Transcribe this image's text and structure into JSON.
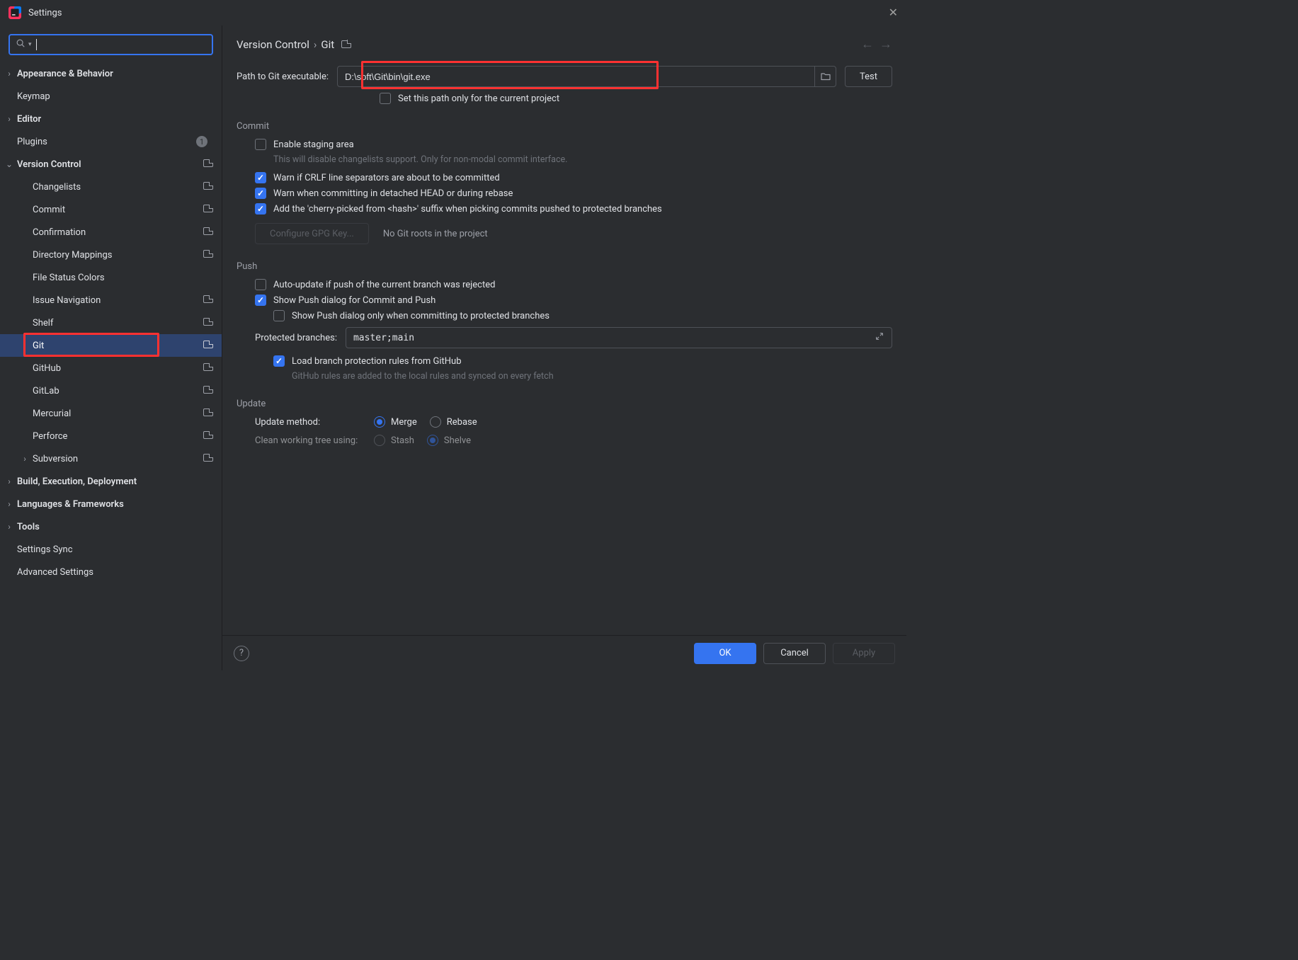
{
  "window": {
    "title": "Settings"
  },
  "search": {
    "placeholder": ""
  },
  "tree": {
    "appearance": "Appearance & Behavior",
    "keymap": "Keymap",
    "editor": "Editor",
    "plugins": "Plugins",
    "plugins_badge": "1",
    "vcs": "Version Control",
    "changelists": "Changelists",
    "commit": "Commit",
    "confirmation": "Confirmation",
    "directory_mappings": "Directory Mappings",
    "file_status_colors": "File Status Colors",
    "issue_navigation": "Issue Navigation",
    "shelf": "Shelf",
    "git": "Git",
    "github": "GitHub",
    "gitlab": "GitLab",
    "mercurial": "Mercurial",
    "perforce": "Perforce",
    "subversion": "Subversion",
    "build": "Build, Execution, Deployment",
    "languages": "Languages & Frameworks",
    "tools": "Tools",
    "settings_sync": "Settings Sync",
    "advanced": "Advanced Settings"
  },
  "breadcrumb": {
    "parent": "Version Control",
    "current": "Git"
  },
  "path": {
    "label": "Path to Git executable:",
    "value": "D:\\soft\\Git\\bin\\git.exe",
    "test_button": "Test",
    "current_only": "Set this path only for the current project"
  },
  "commit": {
    "title": "Commit",
    "enable_staging": "Enable staging area",
    "staging_hint": "This will disable changelists support. Only for non-modal commit interface.",
    "warn_crlf": "Warn if CRLF line separators are about to be committed",
    "warn_detached": "Warn when committing in detached HEAD or during rebase",
    "cherry_suffix": "Add the 'cherry-picked from <hash>' suffix when picking commits pushed to protected branches",
    "configure_gpg": "Configure GPG Key...",
    "no_roots": "No Git roots in the project"
  },
  "push": {
    "title": "Push",
    "auto_update": "Auto-update if push of the current branch was rejected",
    "show_push_dialog": "Show Push dialog for Commit and Push",
    "show_push_protected": "Show Push dialog only when committing to protected branches",
    "protected_label": "Protected branches:",
    "protected_value": "master;main",
    "load_rules": "Load branch protection rules from GitHub",
    "rules_hint": "GitHub rules are added to the local rules and synced on every fetch"
  },
  "update": {
    "title": "Update",
    "method_label": "Update method:",
    "merge": "Merge",
    "rebase": "Rebase",
    "clean_label": "Clean working tree using:",
    "stash": "Stash",
    "shelve": "Shelve"
  },
  "footer": {
    "ok": "OK",
    "cancel": "Cancel",
    "apply": "Apply"
  }
}
